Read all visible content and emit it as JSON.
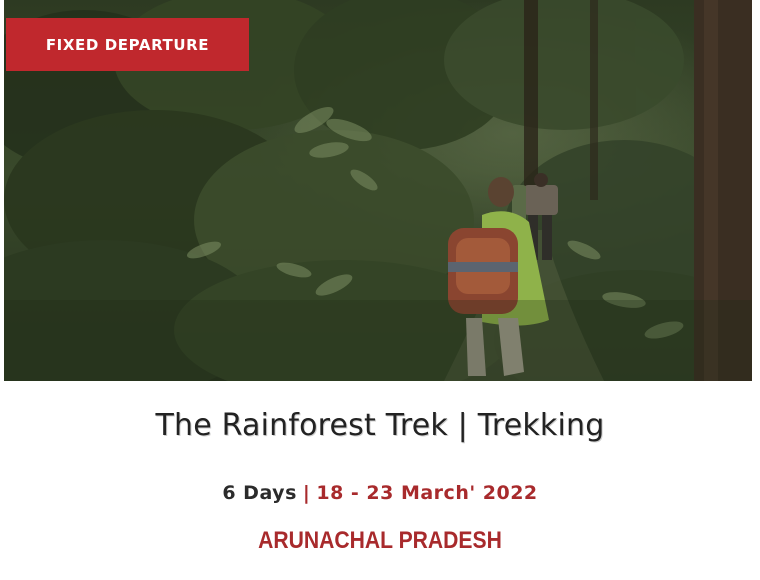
{
  "badge": {
    "label": "FIXED DEPARTURE",
    "color": "#c0282d"
  },
  "photo": {
    "subject": "trekkers-walking-forest-trail"
  },
  "trek": {
    "title": "The Rainforest Trek | Trekking",
    "duration": "6 Days",
    "separator": "|",
    "dates": "18 - 23 March' 2022",
    "region": "ARUNACHAL PRADESH"
  },
  "colors": {
    "accent": "#a82a2c",
    "title_text": "#222222",
    "body_text": "#2b2b2b",
    "background": "#ffffff"
  }
}
